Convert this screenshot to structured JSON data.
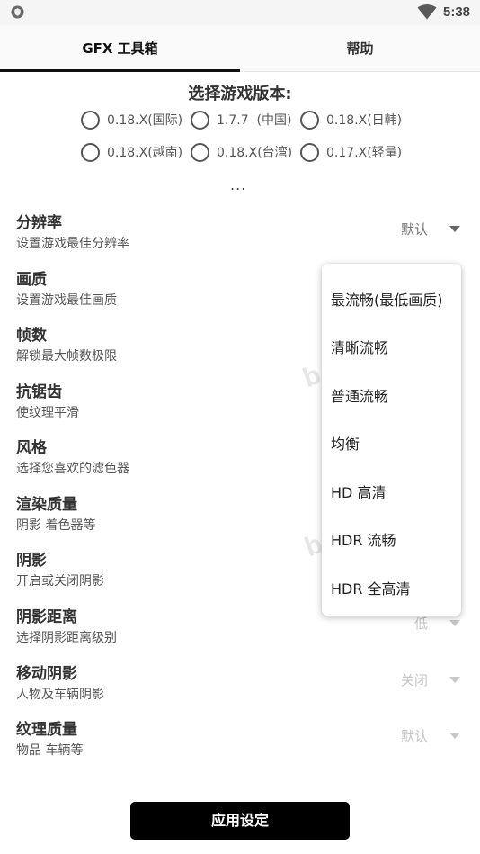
{
  "status_bar": {
    "time": "5:38",
    "app_icon": "shield-icon",
    "wifi_icon": "wifi-icon"
  },
  "tabs": [
    {
      "label": "GFX 工具箱",
      "selected": true
    },
    {
      "label": "帮助",
      "selected": false
    }
  ],
  "version_section": {
    "title": "选择游戏版本:",
    "options": [
      "0.18.X(国际)",
      "1.7.7  (中国)",
      "0.18.X(日韩)",
      "0.18.X(越南)",
      "0.18.X(台湾)",
      "0.17.X(轻量)"
    ],
    "more": "..."
  },
  "settings": [
    {
      "title": "分辨率",
      "subtitle": "设置游戏最佳分辨率",
      "value": "默认"
    },
    {
      "title": "画质",
      "subtitle": "设置游戏最佳画质"
    },
    {
      "title": "帧数",
      "subtitle": "解锁最大帧数极限"
    },
    {
      "title": "抗锯齿",
      "subtitle": "使纹理平滑"
    },
    {
      "title": "风格",
      "subtitle": "选择您喜欢的滤色器"
    },
    {
      "title": "渲染质量",
      "subtitle": "阴影 着色器等"
    },
    {
      "title": "阴影",
      "subtitle": "开启或关闭阴影"
    },
    {
      "title": "阴影距离",
      "subtitle": "选择阴影距离级别",
      "value": "低"
    },
    {
      "title": "移动阴影",
      "subtitle": "人物及车辆阴影",
      "value": "关闭"
    },
    {
      "title": "纹理质量",
      "subtitle": "物品 车辆等",
      "value": "默认"
    }
  ],
  "dropdown": {
    "options": [
      "最流畅(最低画质)",
      "清晰流畅",
      "普通流畅",
      "均衡",
      "HD 高清",
      "HDR 流畅",
      "HDR 全高清"
    ]
  },
  "apply_button": "应用设定",
  "colors": {
    "accent": "#000000",
    "text": "#333333",
    "muted": "#777777"
  }
}
